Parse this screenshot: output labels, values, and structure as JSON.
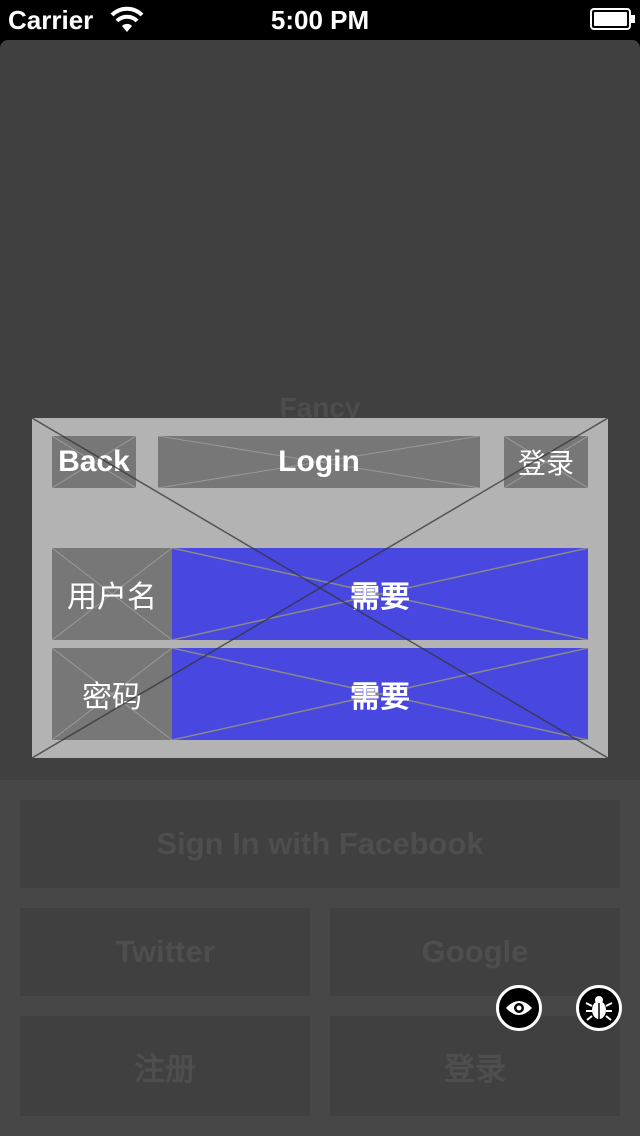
{
  "status_bar": {
    "carrier": "Carrier",
    "time": "5:00 PM",
    "wifi_icon": "wifi-icon",
    "battery_icon": "battery-icon"
  },
  "background": {
    "title": "Fancy"
  },
  "login_panel": {
    "back_label": "Back",
    "title": "Login",
    "login_label": "登录",
    "username_label": "用户名",
    "username_value": "需要",
    "password_label": "密码",
    "password_value": "需要"
  },
  "social": {
    "facebook_label": "Sign In with Facebook",
    "twitter_label": "Twitter",
    "google_label": "Google",
    "register_label": "注册",
    "login_label": "登录"
  },
  "debug_tools": {
    "eye_icon": "eye-icon",
    "bug_icon": "bug-icon"
  },
  "colors": {
    "background": "#404040",
    "panel": "#b3b3b3",
    "input": "#4848e0",
    "nav_item": "#777777"
  }
}
